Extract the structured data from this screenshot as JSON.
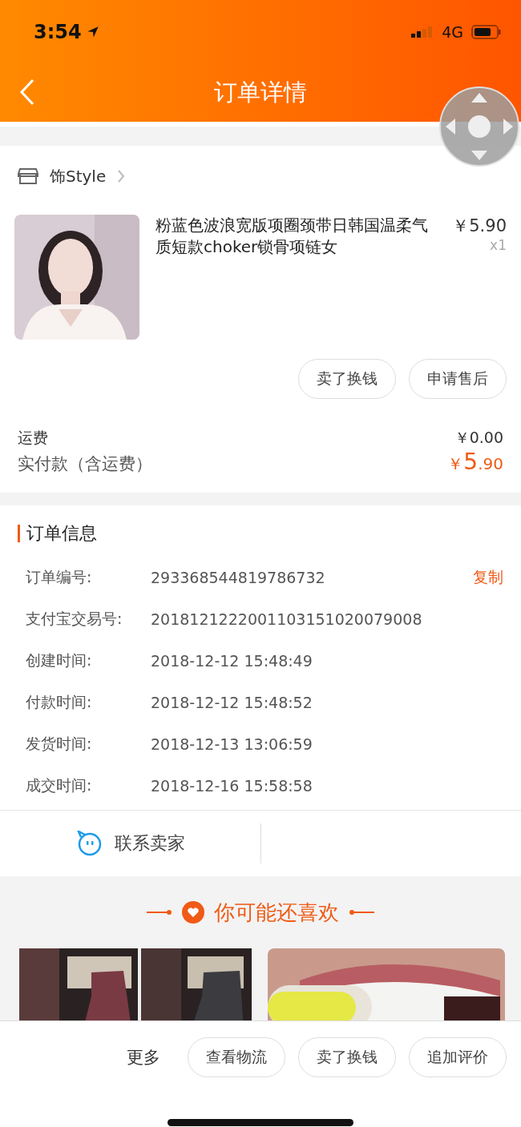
{
  "status_bar": {
    "time": "3:54",
    "network": "4G"
  },
  "nav": {
    "title": "订单详情"
  },
  "store": {
    "name": "饰Style"
  },
  "product": {
    "title": "粉蓝色波浪宽版项圈颈带日韩国温柔气质短款choker锁骨项链女",
    "price": "￥5.90",
    "quantity": "x1",
    "kind": "picture",
    "actions": [
      "卖了换钱",
      "申请售后"
    ]
  },
  "fees": [
    {
      "label": "运费",
      "value": "￥0.00",
      "kind": "plain"
    },
    {
      "label": "实付款（含运费）",
      "value_symbol": "￥",
      "value_int": "5",
      "value_dec": ".90",
      "kind": "total"
    }
  ],
  "order_info": {
    "title": "订单信息",
    "rows": [
      {
        "label": "订单编号:",
        "value": "293368544819786732",
        "action": "复制"
      },
      {
        "label": "支付宝交易号:",
        "value": "2018121222001103151020079008"
      },
      {
        "label": "创建时间:",
        "value": "2018-12-12 15:48:49"
      },
      {
        "label": "付款时间:",
        "value": "2018-12-12 15:48:52"
      },
      {
        "label": "发货时间:",
        "value": "2018-12-13 13:06:59"
      },
      {
        "label": "成交时间:",
        "value": "2018-12-16 15:58:58"
      }
    ]
  },
  "contact": {
    "label": "联系卖家"
  },
  "recommend": {
    "title": "你可能还喜欢",
    "items": [
      {
        "kind": "boots"
      },
      {
        "kind": "mouth"
      }
    ]
  },
  "bottom_bar": {
    "more": "更多",
    "buttons": [
      "查看物流",
      "卖了换钱",
      "追加评价"
    ]
  }
}
